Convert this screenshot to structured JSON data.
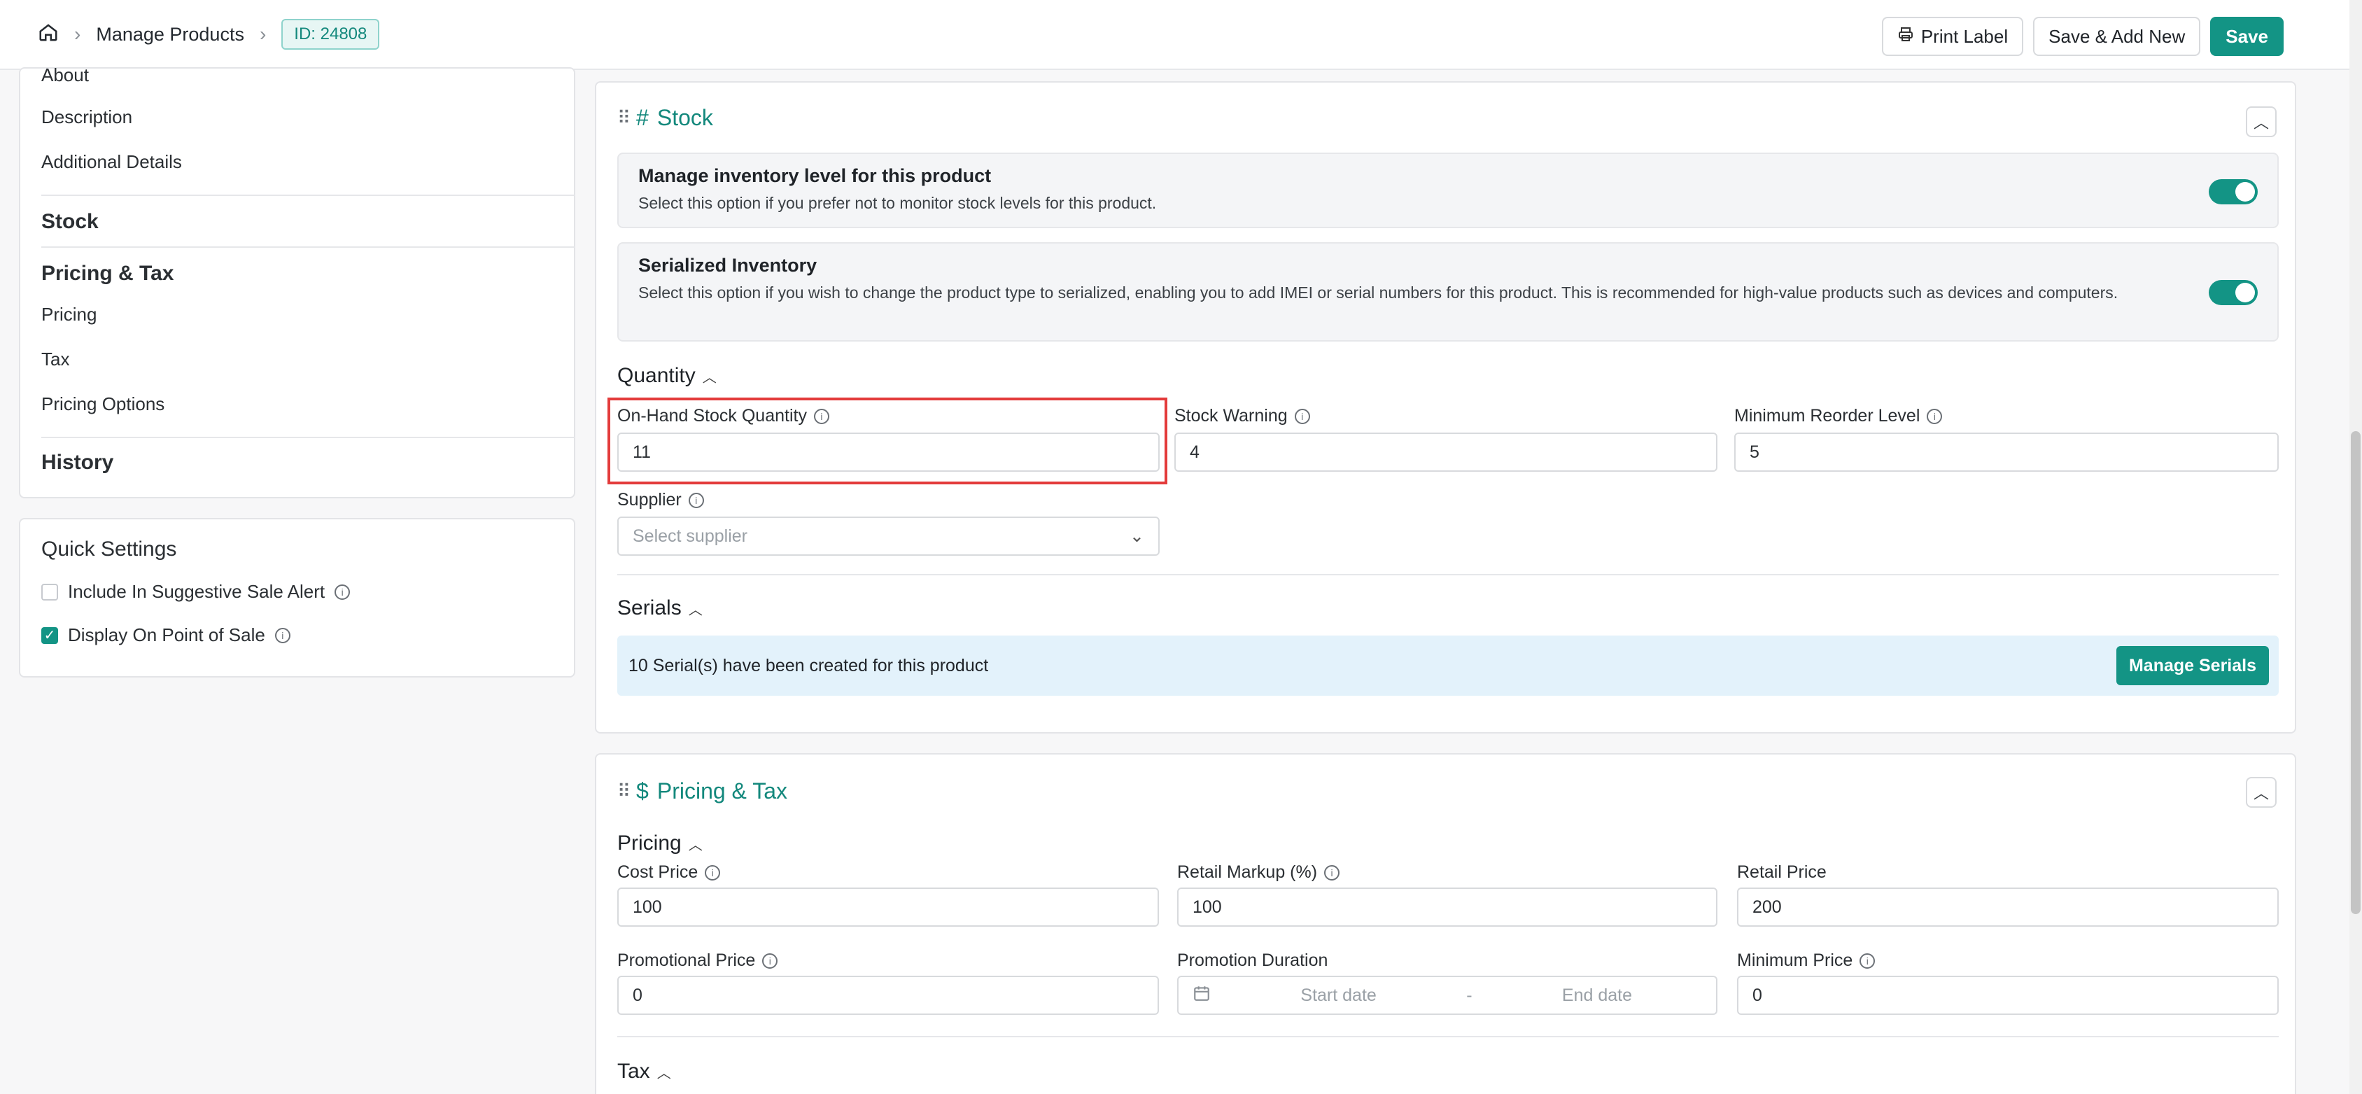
{
  "header": {
    "breadcrumb": {
      "section": "Manage Products",
      "id_badge": "ID: 24808"
    },
    "actions": {
      "print": "Print Label",
      "save_add": "Save & Add New",
      "save": "Save"
    }
  },
  "sidebar": {
    "nav": {
      "partial_item": "About",
      "items": [
        "Description",
        "Additional Details"
      ],
      "stock_heading": "Stock",
      "pricing_heading": "Pricing & Tax",
      "pricing_items": [
        "Pricing",
        "Tax",
        "Pricing Options"
      ],
      "history_heading": "History"
    },
    "quick_settings": {
      "title": "Quick Settings",
      "include_alert": {
        "label": "Include In Suggestive Sale Alert",
        "checked": false
      },
      "display_pos": {
        "label": "Display On Point of Sale",
        "checked": true
      }
    }
  },
  "stock": {
    "title": "Stock",
    "manage_inventory": {
      "title": "Manage inventory level for this product",
      "desc": "Select this option if you prefer not to monitor stock levels for this product.",
      "enabled": true
    },
    "serialized": {
      "title": "Serialized Inventory",
      "desc": "Select this option if you wish to change the product type to serialized, enabling you to add IMEI or serial numbers for this product. This is recommended for high-value products such as devices and computers.",
      "enabled": true
    },
    "quantity": {
      "heading": "Quantity",
      "on_hand": {
        "label": "On-Hand Stock Quantity",
        "value": "11"
      },
      "warning": {
        "label": "Stock Warning",
        "value": "4"
      },
      "reorder": {
        "label": "Minimum Reorder Level",
        "value": "5"
      },
      "supplier": {
        "label": "Supplier",
        "placeholder": "Select supplier"
      }
    },
    "serials": {
      "heading": "Serials",
      "message": "10 Serial(s) have been created for this product",
      "button": "Manage Serials"
    }
  },
  "pricing": {
    "title": "Pricing & Tax",
    "heading": "Pricing",
    "cost": {
      "label": "Cost Price",
      "value": "100"
    },
    "markup": {
      "label": "Retail Markup (%)",
      "value": "100"
    },
    "retail": {
      "label": "Retail Price",
      "value": "200"
    },
    "promo": {
      "label": "Promotional Price",
      "value": "0"
    },
    "duration": {
      "label": "Promotion Duration",
      "start": "Start date",
      "sep": "-",
      "end": "End date"
    },
    "minimum": {
      "label": "Minimum Price",
      "value": "0"
    },
    "tax_heading": "Tax"
  },
  "colors": {
    "accent": "#139485",
    "highlight": "#e33b3b",
    "serial_bg": "#e3f2fb"
  }
}
